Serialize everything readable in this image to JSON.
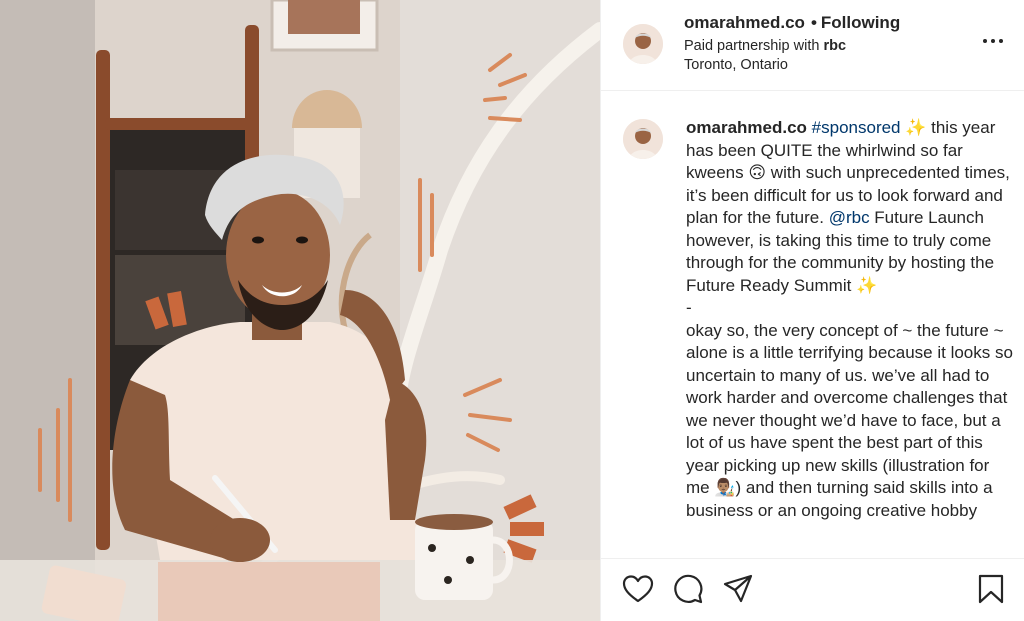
{
  "post": {
    "username": "omarahmed.co",
    "follow_status": "Following",
    "partnership_prefix": "Paid partnership with ",
    "partner": "rbc",
    "location": "Toronto, Ontario"
  },
  "caption": {
    "username": "omarahmed.co",
    "hashtag": "#sponsored",
    "text_1": " ✨ this year has been QUITE the whirlwind so far kweens 🙃 with such unprecedented times, it’s been difficult for us to look forward and plan for the future. ",
    "mention": "@rbc",
    "text_2": " Future Launch however, is taking this time to truly come through for the community by hosting the Future Ready Summit ✨\n-\nokay so, the very concept of ~ the future ~ alone is a little terrifying because it looks so uncertain to many of us. we’ve all had to work harder and overcome challenges that we never thought we’d have to face, but a lot of us have spent the best part of this year picking up new skills (illustration for me 👨🏽‍🎨) and then turning said skills into a business or an ongoing creative hobby"
  },
  "icons": {
    "more": "more-options-icon",
    "like": "heart-icon",
    "comment": "comment-icon",
    "share": "share-icon",
    "save": "bookmark-icon"
  },
  "colors": {
    "text": "#262626",
    "link": "#00376b",
    "accent_illustration": "#d98a5c"
  }
}
